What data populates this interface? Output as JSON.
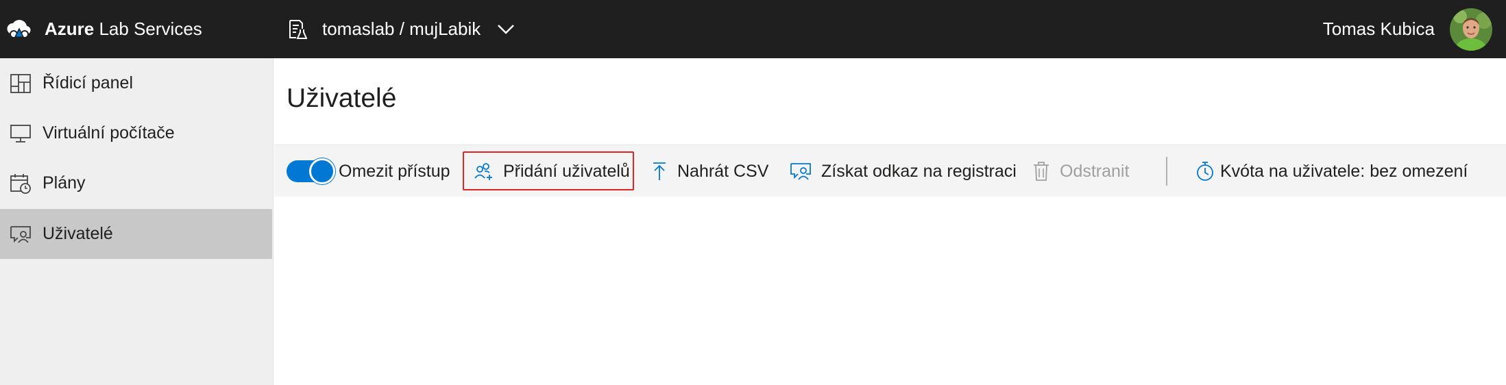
{
  "topbar": {
    "brand_bold": "Azure",
    "brand_rest": " Lab Services",
    "lab_name": "tomaslab / mujLabik",
    "user_name": "Tomas Kubica"
  },
  "sidebar": {
    "items": [
      {
        "label": "Řídicí panel",
        "icon": "dashboard-icon",
        "active": false
      },
      {
        "label": "Virtuální počítače",
        "icon": "monitor-icon",
        "active": false
      },
      {
        "label": "Plány",
        "icon": "calendar-clock-icon",
        "active": false
      },
      {
        "label": "Uživatelé",
        "icon": "users-chat-icon",
        "active": true
      }
    ]
  },
  "main": {
    "title": "Uživatelé"
  },
  "toolbar": {
    "restrict_access_label": "Omezit přístup",
    "restrict_access_on": true,
    "add_users_label": "Přidání uživatelů",
    "upload_csv_label": "Nahrát CSV",
    "registration_link_label": "Získat odkaz na registraci",
    "delete_label": "Odstranit",
    "quota_label": "Kvóta na uživatele: bez omezení"
  },
  "colors": {
    "topbar_bg": "#201f1f",
    "accent": "#0078d4",
    "sidebar_bg": "#efefef",
    "sidebar_active_bg": "#c8c8c8",
    "highlight_border": "#e02424",
    "disabled_text": "#a19f9d"
  }
}
